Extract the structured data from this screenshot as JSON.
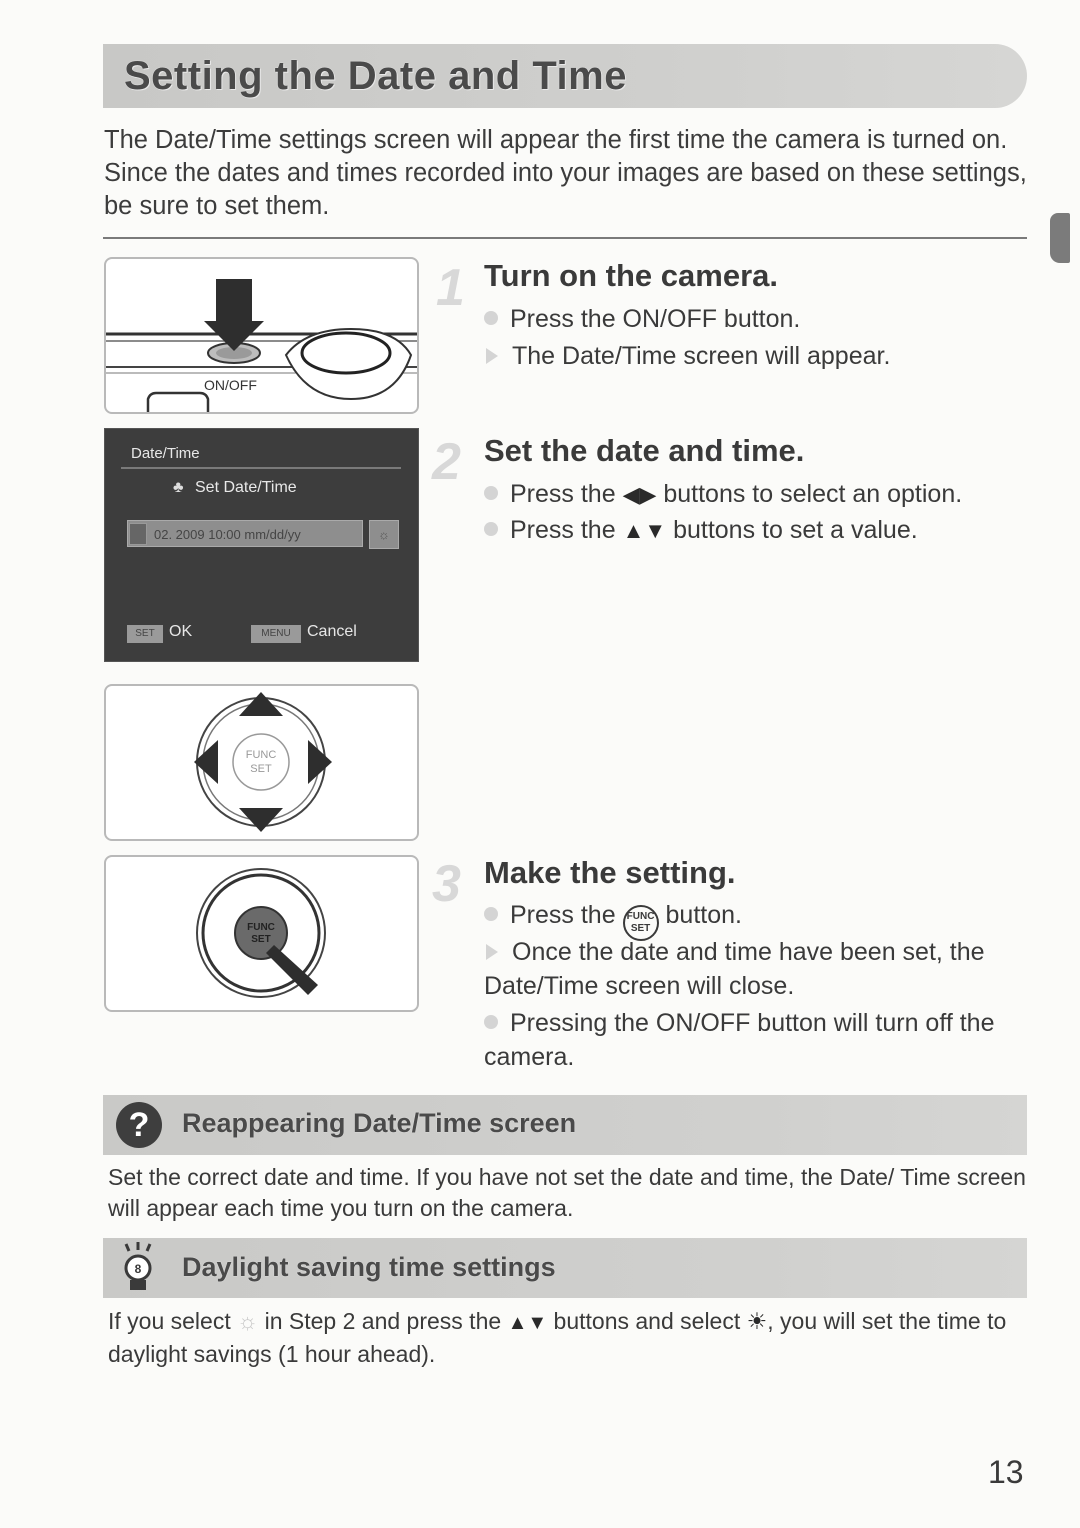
{
  "page": {
    "title": "Setting the Date and Time",
    "intro": "The Date/Time settings screen will appear the first time the camera is turned on. Since the dates and times recorded into your images are based on these settings, be sure to set them.",
    "page_number": "13"
  },
  "illustrations": {
    "onoff_label": "ON/OFF",
    "lcd": {
      "title": "Date/Time",
      "subtitle": "Set Date/Time",
      "field_value": "02. 2009 10:00 mm/dd/yy",
      "ok_button": "SET",
      "ok_label": "OK",
      "menu_button": "MENU",
      "cancel_label": "Cancel"
    },
    "func_set_label": "FUNC SET"
  },
  "steps": [
    {
      "number": "1",
      "title": "Turn on the camera.",
      "lines": [
        {
          "type": "bullet",
          "text": "Press the ON/OFF button."
        },
        {
          "type": "result",
          "text": "The Date/Time screen will appear."
        }
      ]
    },
    {
      "number": "2",
      "title": "Set the date and time.",
      "lines": [
        {
          "type": "bullet",
          "pre": "Press the",
          "glyph": "◀▶",
          "post": "buttons to select an option."
        },
        {
          "type": "bullet",
          "pre": "Press the",
          "glyph": "▲▼",
          "post": "buttons to set a value."
        }
      ]
    },
    {
      "number": "3",
      "title": "Make the setting.",
      "lines": [
        {
          "type": "bullet",
          "pre": "Press the",
          "glyph": "FUNC SET",
          "post": "button."
        },
        {
          "type": "result",
          "text": "Once the date and time have been set, the Date/Time screen will close."
        },
        {
          "type": "bullet",
          "text": "Pressing the ON/OFF button will turn off the camera."
        }
      ]
    }
  ],
  "callouts": [
    {
      "icon": "question-icon",
      "title": "Reappearing Date/Time screen",
      "body": "Set the correct date and time. If you have not set the date and time, the Date/ Time screen will appear each time you turn on the camera."
    },
    {
      "icon": "lightbulb-icon",
      "title": "Daylight saving time settings",
      "body_pre": "If you select",
      "body_glyph1": "☼",
      "body_mid": "in Step 2 and press the",
      "body_glyph2": "▲▼",
      "body_mid2": "buttons and select",
      "body_glyph3": "☀",
      "body_post": ", you will set the time to daylight savings (1 hour ahead)."
    }
  ]
}
